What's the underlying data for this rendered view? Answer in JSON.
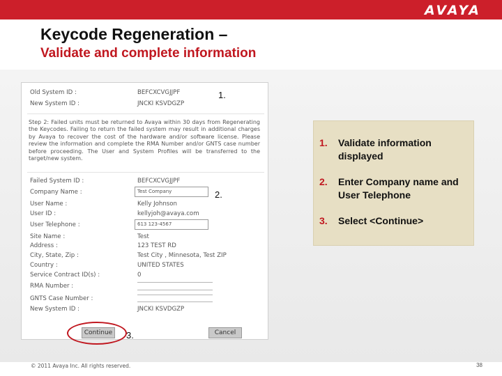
{
  "header": {
    "logo": "AVAYA"
  },
  "slide": {
    "title": "Keycode Regeneration –",
    "subtitle": "Validate and complete information"
  },
  "form": {
    "old_system_id_label": "Old System ID :",
    "old_system_id_value": "BEFCXCVGJJPF",
    "new_system_id_label": "New System ID :",
    "new_system_id_value": "JNCKI KSVDGZP",
    "step2_text": "Step 2: Failed units must be returned to Avaya within 30 days from Regenerating the Keycodes. Failing to return the failed system may result in additional charges by Avaya to recover the cost of the hardware and/or software license. Please review the information and complete the RMA Number and/or GNTS case number before proceeding. The User and System Profiles will be transferred to the target/new system.",
    "fields": [
      {
        "label": "Failed System ID :",
        "value": "BEFCXCVGJJPF"
      },
      {
        "label": "Company Name :",
        "value": "Test Company"
      },
      {
        "label": "User Name :",
        "value": "Kelly Johnson"
      },
      {
        "label": "User ID :",
        "value": "kellyjoh@avaya.com"
      },
      {
        "label": "User Telephone :",
        "value": "613 123-4567"
      },
      {
        "label": "Site Name :",
        "value": "Test"
      },
      {
        "label": "Address :",
        "value": "123 TEST RD"
      },
      {
        "label": "City, State, Zip :",
        "value": "Test City , Minnesota, Test ZIP"
      },
      {
        "label": "Country :",
        "value": "UNITED STATES"
      },
      {
        "label": "Service Contract ID(s) :",
        "value": "0"
      },
      {
        "label": "RMA Number :",
        "value": ""
      },
      {
        "label": "GNTS Case Number :",
        "value": ""
      },
      {
        "label": "New System ID :",
        "value": "JNCKI KSVDGZP"
      }
    ],
    "continue_label": "Continue",
    "cancel_label": "Cancel"
  },
  "markers": [
    "1.",
    "2.",
    "3."
  ],
  "callout": {
    "items": [
      {
        "num": "1.",
        "text": "Validate information displayed"
      },
      {
        "num": "2.",
        "text": "Enter Company name and User Telephone"
      },
      {
        "num": "3.",
        "text": "Select <Continue>"
      }
    ]
  },
  "footer": {
    "copyright": "© 2011 Avaya Inc. All rights reserved.",
    "page": "38"
  },
  "colors": {
    "brand_red": "#cc1f2a",
    "subtitle_red": "#c0171f",
    "callout_bg": "#e7dfc4"
  }
}
